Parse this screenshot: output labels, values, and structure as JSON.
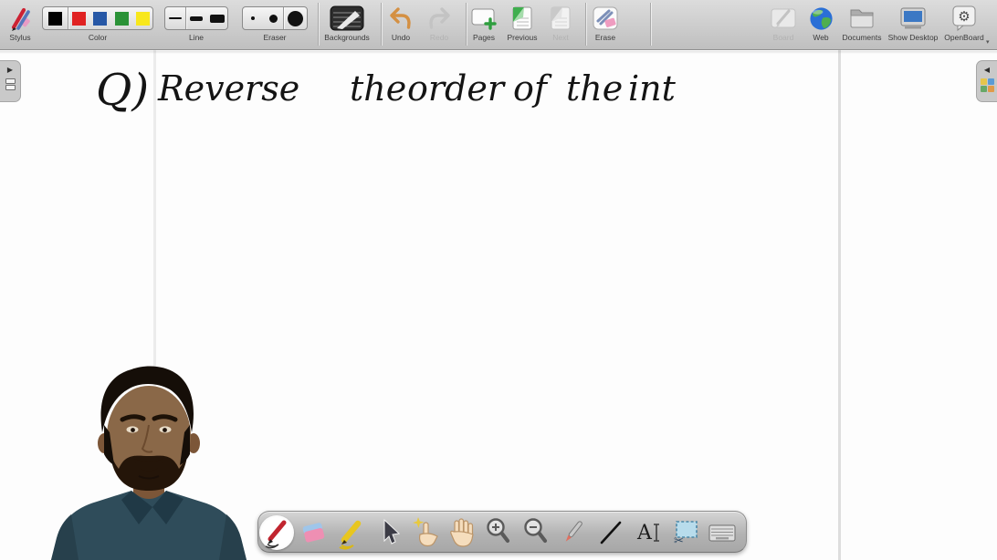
{
  "app": {
    "title": "OpenBoard whiteboard"
  },
  "colors": {
    "toolbar_bg": "#cbcbcb",
    "canvas_bg": "#fdfdfd",
    "ink": "#141414",
    "undo_arrow": "#d49043",
    "page_accent_green": "#3fae4e",
    "erase_pink": "#ef9cc0",
    "stylusbar_bg": "#b3b3b3",
    "shirt_teal": "#2f4c5a",
    "swatches": [
      "#000000",
      "#e02222",
      "#2758a6",
      "#2b9237",
      "#f8e71c"
    ]
  },
  "top_toolbar": {
    "stylus": {
      "label": "Stylus"
    },
    "color": {
      "label": "Color",
      "selected": "black",
      "swatches": [
        "black",
        "red",
        "blue",
        "green",
        "yellow"
      ]
    },
    "line": {
      "label": "Line",
      "selected": "thin"
    },
    "eraser": {
      "label": "Eraser",
      "selected": "large"
    },
    "backgrounds": {
      "label": "Backgrounds"
    },
    "undo": {
      "label": "Undo",
      "enabled": true
    },
    "redo": {
      "label": "Redo",
      "enabled": false
    },
    "pages": {
      "label": "Pages"
    },
    "previous": {
      "label": "Previous",
      "enabled": true
    },
    "next": {
      "label": "Next",
      "enabled": false
    },
    "erase": {
      "label": "Erase"
    },
    "board": {
      "label": "Board",
      "enabled": false
    },
    "web": {
      "label": "Web"
    },
    "documents": {
      "label": "Documents"
    },
    "show_desktop": {
      "label": "Show Desktop"
    },
    "openboard": {
      "label": "OpenBoard"
    }
  },
  "canvas": {
    "handwriting": {
      "prefix": "Q)",
      "words": [
        "Reverse",
        "the",
        "order",
        "of",
        "the",
        "int"
      ],
      "full_text": "Q) Reverse the order of the int",
      "ink_color": "#141414"
    }
  },
  "stylus_bar": {
    "selected_tool": "pen",
    "tools": [
      "pen",
      "eraser",
      "marker",
      "selector",
      "play",
      "hand",
      "zoom-in",
      "zoom-out",
      "pointer",
      "line",
      "text",
      "capture",
      "keyboard"
    ]
  },
  "drawers": {
    "left": "collapsed",
    "right": "collapsed"
  },
  "webcam_overlay": {
    "description": "Presenter with beard wearing dark teal polo shirt"
  },
  "icons": {
    "gear": "⚙",
    "scissors": "✂",
    "text_tool": "A",
    "caret": "▾",
    "left_drawer_arrow": "▶",
    "right_drawer_arrow": "◀"
  }
}
